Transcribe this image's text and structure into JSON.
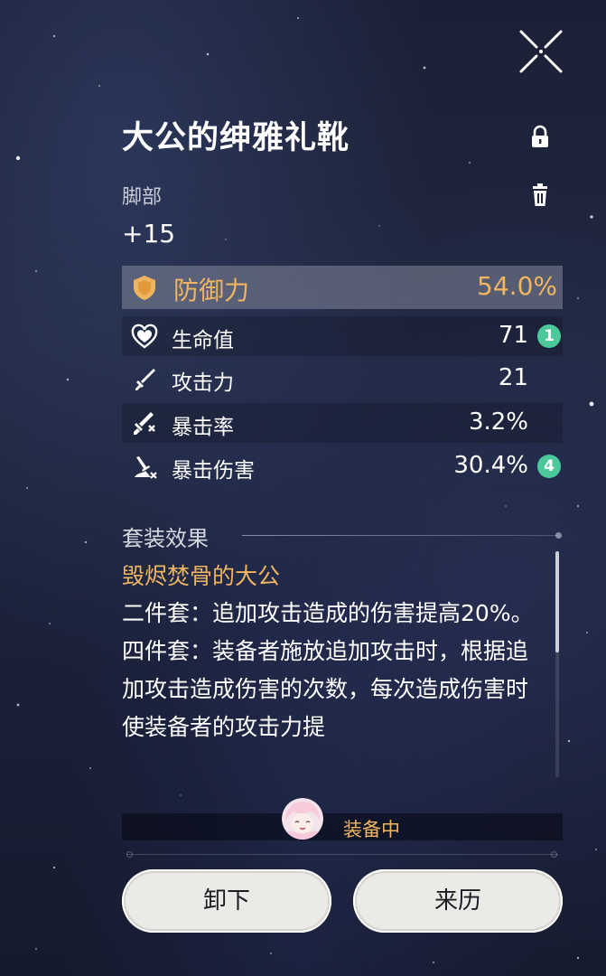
{
  "relic": {
    "name": "大公的绅雅礼靴",
    "slot": "脚部",
    "level": "+15"
  },
  "main_stat": {
    "icon": "shield-icon",
    "name": "防御力",
    "value": "54.0%"
  },
  "sub_stats": [
    {
      "icon": "heart-icon",
      "name": "生命值",
      "value": "71",
      "rolls": "1"
    },
    {
      "icon": "sword-icon",
      "name": "攻击力",
      "value": "21",
      "rolls": ""
    },
    {
      "icon": "crit-rate-icon",
      "name": "暴击率",
      "value": "3.2%",
      "rolls": ""
    },
    {
      "icon": "crit-damage-icon",
      "name": "暴击伤害",
      "value": "30.4%",
      "rolls": "4"
    }
  ],
  "set_effect": {
    "header": "套装效果",
    "set_name": "毁烬焚骨的大公",
    "two_piece": "二件套：追加攻击造成的伤害提高20%。",
    "four_piece": "四件套：装备者施放追加攻击时，根据追加攻击造成伤害的次数，每次造成伤害时使装备者的攻击力提"
  },
  "equipped": {
    "label": "装备中",
    "avatar": "character-avatar"
  },
  "buttons": {
    "unequip": "卸下",
    "source": "来历"
  },
  "colors": {
    "accent_gold": "#f0b560",
    "badge_green": "#4cc99a",
    "button_bg": "#eceae6"
  }
}
